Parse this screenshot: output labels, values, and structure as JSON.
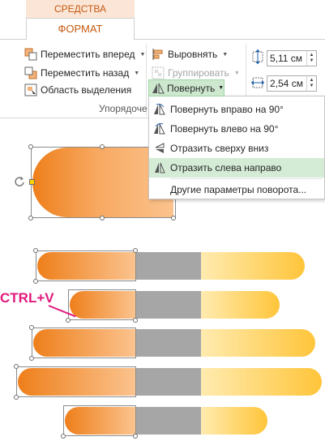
{
  "ribbon": {
    "context_tab": "СРЕДСТВА РИСОВАНИЯ",
    "active_tab": "ФОРМАТ",
    "group_label": "Упорядоче",
    "bring_forward": "Переместить вперед",
    "send_backward": "Переместить назад",
    "selection_pane": "Область выделения",
    "align": "Выровнять",
    "group": "Группировать",
    "rotate": "Повернуть",
    "height_value": "5,11 см",
    "width_value": "2,54 см"
  },
  "rotate_menu": {
    "items": [
      {
        "label": "Повернуть вправо на 90°",
        "icon": "rotate-right-icon"
      },
      {
        "label": "Повернуть влево на 90°",
        "icon": "rotate-left-icon"
      },
      {
        "label": "Отразить сверху вниз",
        "icon": "flip-vertical-icon"
      },
      {
        "label": "Отразить слева направо",
        "icon": "flip-horizontal-icon"
      },
      {
        "label": "Другие параметры поворота...",
        "icon": ""
      }
    ],
    "highlighted_index": 3
  },
  "annotation": {
    "ctrl_v": "CTRL+V"
  },
  "colors": {
    "accent_orange": "#c55a11",
    "menu_highlight": "#d4ebd6",
    "annotation_magenta": "#e0197d",
    "gray_segment": "#a6a6a6"
  }
}
